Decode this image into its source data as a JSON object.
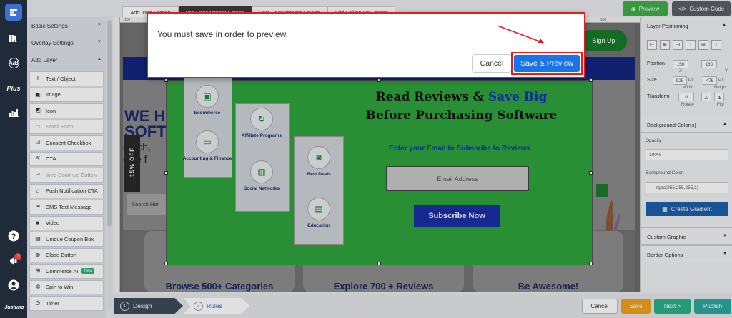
{
  "rail": {
    "notification_count": "1",
    "brand": "Justuno",
    "icons": [
      "builder-icon",
      "library-icon",
      "ab-test-icon",
      "plus-icon",
      "analytics-icon",
      "help-icon",
      "notifications-icon",
      "account-icon"
    ],
    "ab_label": "A/B",
    "plus_label": "Plus"
  },
  "tabs": [
    "Add Intro Screen",
    "Pre-Engagement Screen",
    "Post-Engagement Screen",
    "Add Follow-Up Screen"
  ],
  "top_buttons": {
    "preview": "Preview",
    "custom_code": "Custom Code"
  },
  "left_panel": {
    "sections": [
      "Basic Settings",
      "Overlay Settings",
      "Add Layer"
    ],
    "layers": [
      {
        "label": "Text / Object",
        "icon": "text-icon",
        "disabled": false
      },
      {
        "label": "Image",
        "icon": "image-icon",
        "disabled": false
      },
      {
        "label": "Icon",
        "icon": "icon-icon",
        "disabled": false
      },
      {
        "label": "Email Form",
        "icon": "form-icon",
        "disabled": true
      },
      {
        "label": "Consent Checkbox",
        "icon": "checkbox-icon",
        "disabled": false
      },
      {
        "label": "CTA",
        "icon": "cta-icon",
        "disabled": false
      },
      {
        "label": "Intro Continue Button",
        "icon": "continue-icon",
        "disabled": true
      },
      {
        "label": "Push Notification CTA",
        "icon": "push-icon",
        "disabled": false
      },
      {
        "label": "SMS Text Message",
        "icon": "sms-icon",
        "disabled": false
      },
      {
        "label": "Video",
        "icon": "video-icon",
        "disabled": false
      },
      {
        "label": "Unique Coupon Box",
        "icon": "coupon-icon",
        "disabled": false
      },
      {
        "label": "Close Button",
        "icon": "close-icon",
        "disabled": false
      },
      {
        "label": "Commerce AI",
        "icon": "cart-icon",
        "disabled": false,
        "badge": "New"
      },
      {
        "label": "Spin to Win",
        "icon": "spin-icon",
        "disabled": false
      },
      {
        "label": "Timer",
        "icon": "timer-icon",
        "disabled": false
      }
    ]
  },
  "canvas": {
    "ruler_left": "100",
    "ruler_right": "950",
    "site": {
      "signup": "Sign Up",
      "hero_line1": "WE H",
      "hero_line2": "SOFT",
      "hero_sub1": "earch,",
      "hero_sub2": "oice f",
      "search_placeholder": "Search Her",
      "card_titles": [
        "Browse 500+ Categories",
        "Explore 700 + Reviews",
        "Be Awesome!"
      ],
      "vertical_tab": "15% OFF"
    },
    "popup": {
      "headline_part1": "Read Reviews  &",
      "headline_blue": "Save Big",
      "headline_line2": "Before Purchasing Software",
      "subhead": "Enter your Email to Subscribe to Reviews",
      "email_placeholder": "Email Address",
      "subscribe": "Subscribe Now",
      "categories": [
        {
          "label": "Ecommerce",
          "icon": "shopping-bag-icon"
        },
        {
          "label": "Accounting & Finance",
          "icon": "money-icon"
        },
        {
          "label": "Affiliate Programs",
          "icon": "affiliate-icon"
        },
        {
          "label": "Social Networks",
          "icon": "bar-chart-icon"
        },
        {
          "label": "Best Deals",
          "icon": "briefcase-icon"
        },
        {
          "label": "Education",
          "icon": "book-icon"
        }
      ]
    }
  },
  "right_panel": {
    "header": "Layer Positioning",
    "position_label": "Position",
    "position_x": "150",
    "position_y": "160",
    "x_label": "X",
    "y_label": "Y",
    "size_label": "Size",
    "width": "928",
    "height": "475",
    "unit": "PX",
    "width_label": "Width",
    "height_label": "Height",
    "transform_label": "Transform",
    "rotate_value": "0",
    "rotate_label": "Rotate °",
    "flip_label": "Flip",
    "background_colors": "Background Color(s)",
    "opacity_label": "Opacity",
    "opacity_value": "100%",
    "bg_color_label": "Background Color:",
    "bg_color_value": "rgba(255,255,255,1)",
    "create_gradient": "Create Gradient",
    "custom_graphic": "Custom Graphic",
    "border_options": "Border Options"
  },
  "bottom": {
    "step1_num": "1",
    "step1": "Design",
    "step2_num": "2",
    "step2": "Rules",
    "cancel": "Cancel",
    "save": "Save",
    "next": "Next >",
    "publish": "Publish"
  },
  "modal": {
    "message": "You must save in order to preview.",
    "cancel": "Cancel",
    "save_preview": "Save & Preview"
  },
  "colors": {
    "popup_green": "#2ea33d",
    "modal_highlight": "#e02020",
    "primary_blue": "#1a73e8",
    "headline_blue": "#1332b8"
  }
}
